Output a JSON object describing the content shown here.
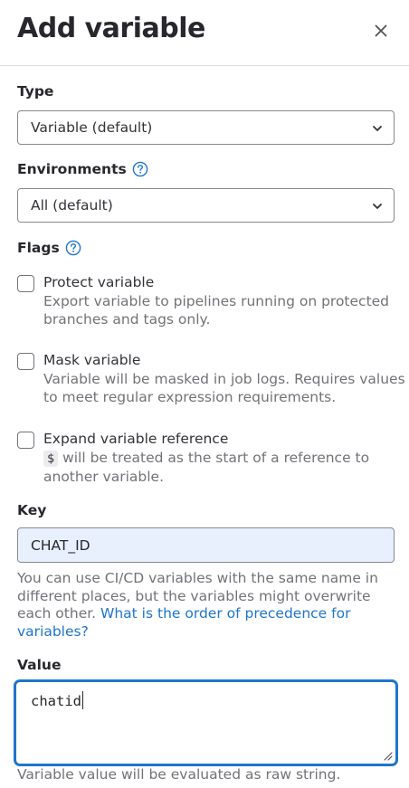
{
  "header": {
    "title": "Add variable",
    "close_icon": "close-icon"
  },
  "type": {
    "label": "Type",
    "selected": "Variable (default)"
  },
  "environments": {
    "label": "Environments",
    "selected": "All (default)"
  },
  "flags": {
    "label": "Flags",
    "protect": {
      "label": "Protect variable",
      "help": "Export variable to pipelines running on protected branches and tags only.",
      "checked": false
    },
    "mask": {
      "label": "Mask variable",
      "help": "Variable will be masked in job logs. Requires values to meet regular expression requirements.",
      "checked": false
    },
    "expand": {
      "label": "Expand variable reference",
      "help_code": "$",
      "help": " will be treated as the start of a reference to another variable.",
      "checked": false
    }
  },
  "key": {
    "label": "Key",
    "value": "CHAT_ID",
    "help": "You can use CI/CD variables with the same name in different places, but the variables might overwrite each other. ",
    "help_link": "What is the order of precedence for variables?"
  },
  "value": {
    "label": "Value",
    "value": "chatid",
    "help": "Variable value will be evaluated as raw string."
  },
  "colors": {
    "link": "#1f75cb",
    "focus": "#1f75cb",
    "autofill": "#e8f0fe"
  }
}
